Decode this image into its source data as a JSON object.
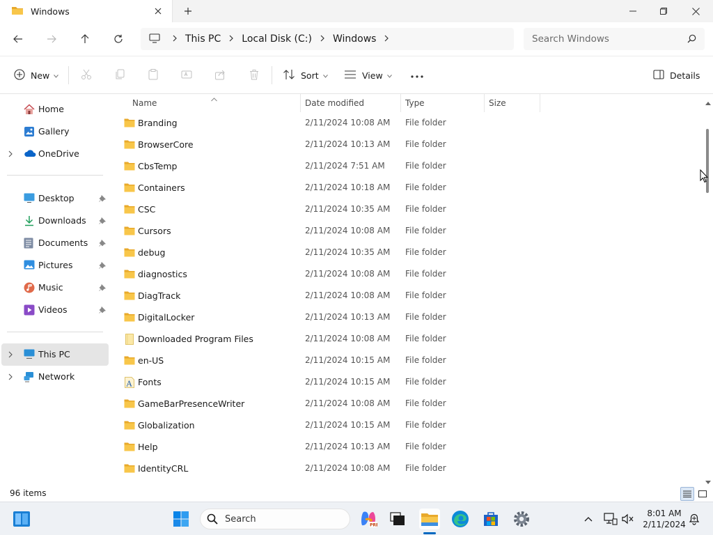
{
  "window": {
    "tab_title": "Windows"
  },
  "breadcrumb": [
    "This PC",
    "Local Disk (C:)",
    "Windows"
  ],
  "search": {
    "placeholder": "Search Windows"
  },
  "toolbar": {
    "new_label": "New",
    "sort_label": "Sort",
    "view_label": "View",
    "details_label": "Details"
  },
  "sidebar": {
    "top": [
      {
        "label": "Home",
        "icon": "home-icon"
      },
      {
        "label": "Gallery",
        "icon": "gallery-icon"
      },
      {
        "label": "OneDrive",
        "icon": "cloud-icon"
      }
    ],
    "quick": [
      {
        "label": "Desktop",
        "icon": "desktop-icon"
      },
      {
        "label": "Downloads",
        "icon": "download-icon"
      },
      {
        "label": "Documents",
        "icon": "documents-icon"
      },
      {
        "label": "Pictures",
        "icon": "pictures-icon"
      },
      {
        "label": "Music",
        "icon": "music-icon"
      },
      {
        "label": "Videos",
        "icon": "videos-icon"
      }
    ],
    "bottom": [
      {
        "label": "This PC",
        "icon": "computer-icon"
      },
      {
        "label": "Network",
        "icon": "network-icon"
      }
    ]
  },
  "columns": {
    "name": "Name",
    "date": "Date modified",
    "type": "Type",
    "size": "Size"
  },
  "files": [
    {
      "name": "Branding",
      "date": "2/11/2024 10:08 AM",
      "type": "File folder"
    },
    {
      "name": "BrowserCore",
      "date": "2/11/2024 10:13 AM",
      "type": "File folder"
    },
    {
      "name": "CbsTemp",
      "date": "2/11/2024 7:51 AM",
      "type": "File folder"
    },
    {
      "name": "Containers",
      "date": "2/11/2024 10:18 AM",
      "type": "File folder"
    },
    {
      "name": "CSC",
      "date": "2/11/2024 10:35 AM",
      "type": "File folder"
    },
    {
      "name": "Cursors",
      "date": "2/11/2024 10:08 AM",
      "type": "File folder"
    },
    {
      "name": "debug",
      "date": "2/11/2024 10:35 AM",
      "type": "File folder"
    },
    {
      "name": "diagnostics",
      "date": "2/11/2024 10:08 AM",
      "type": "File folder"
    },
    {
      "name": "DiagTrack",
      "date": "2/11/2024 10:08 AM",
      "type": "File folder"
    },
    {
      "name": "DigitalLocker",
      "date": "2/11/2024 10:13 AM",
      "type": "File folder"
    },
    {
      "name": "Downloaded Program Files",
      "date": "2/11/2024 10:08 AM",
      "type": "File folder"
    },
    {
      "name": "en-US",
      "date": "2/11/2024 10:15 AM",
      "type": "File folder"
    },
    {
      "name": "Fonts",
      "date": "2/11/2024 10:15 AM",
      "type": "File folder"
    },
    {
      "name": "GameBarPresenceWriter",
      "date": "2/11/2024 10:08 AM",
      "type": "File folder"
    },
    {
      "name": "Globalization",
      "date": "2/11/2024 10:15 AM",
      "type": "File folder"
    },
    {
      "name": "Help",
      "date": "2/11/2024 10:13 AM",
      "type": "File folder"
    },
    {
      "name": "IdentityCRL",
      "date": "2/11/2024 10:08 AM",
      "type": "File folder"
    }
  ],
  "status": {
    "count": "96 items"
  },
  "taskbar": {
    "search_label": "Search",
    "time": "8:01 AM",
    "date": "2/11/2024"
  },
  "colors": {
    "folder": "#f8c64a",
    "accent": "#0067c0",
    "selected": "#e5e5e5"
  }
}
